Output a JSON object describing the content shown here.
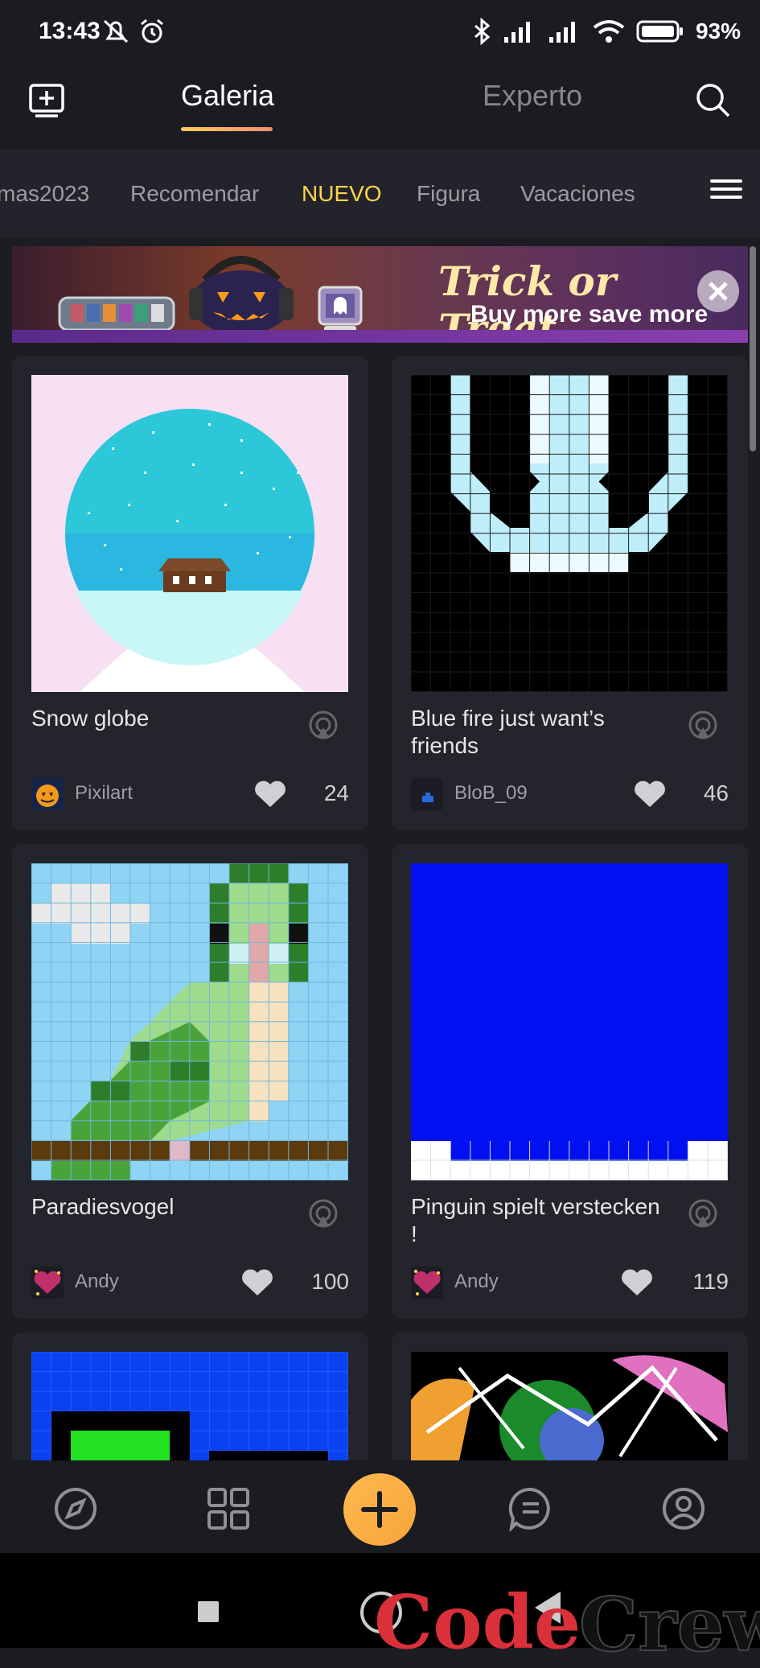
{
  "status": {
    "time": "13:43",
    "battery": "93%"
  },
  "header": {
    "tab_gallery": "Galeria",
    "tab_expert": "Experto"
  },
  "categories": [
    "mas2023",
    "Recomendar",
    "NUEVO",
    "Figura",
    "Vacaciones"
  ],
  "banner": {
    "title": "Trick or Treat",
    "subtitle": "Buy more save more"
  },
  "cards": [
    {
      "title": "Snow globe",
      "author": "Pixilart",
      "likes": "24"
    },
    {
      "title": "Blue fire just want’s friends",
      "author": "BloB_09",
      "likes": "46"
    },
    {
      "title": "Paradiesvogel",
      "author": "Andy",
      "likes": "100"
    },
    {
      "title": "Pinguin spielt verstecken !",
      "author": "Andy",
      "likes": "119"
    }
  ],
  "colors": {
    "accent_tab": "#ffcd58",
    "category_active": "#ffd54a",
    "add_button": "#f7a53a"
  },
  "watermark": {
    "text_red": "Code",
    "text_dark": "Crew"
  }
}
